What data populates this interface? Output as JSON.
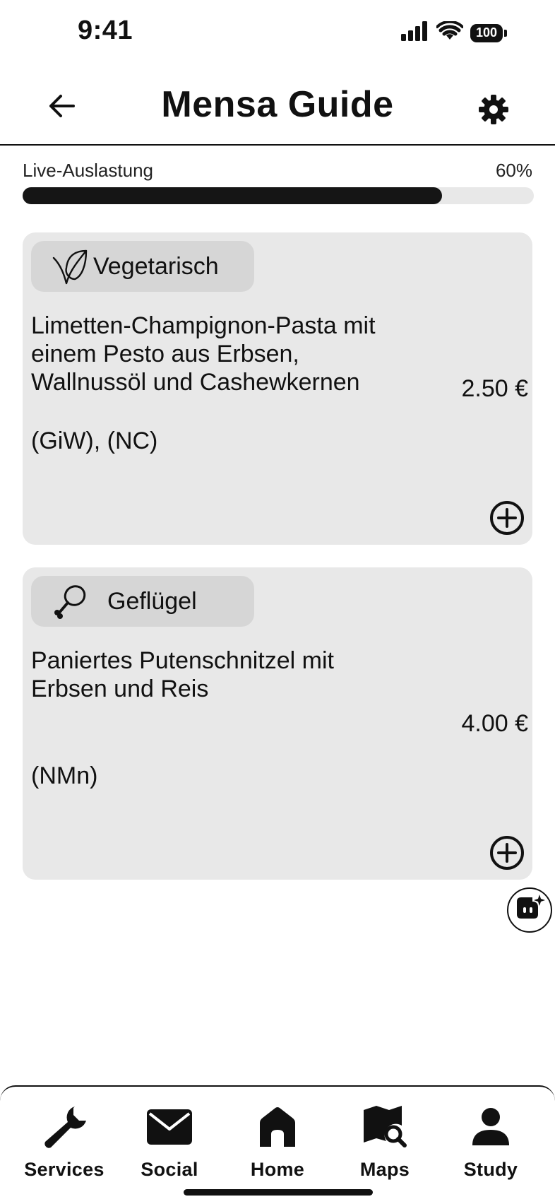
{
  "status_bar": {
    "time": "9:41",
    "battery": "100"
  },
  "header": {
    "title": "Mensa Guide",
    "back_icon": "arrow-left-icon",
    "settings_icon": "gear-icon"
  },
  "utilization": {
    "label": "Live-Auslastung",
    "value_text": "60%",
    "fraction": 0.82
  },
  "meals": [
    {
      "category": "Vegetarisch",
      "category_icon": "leaf-icon",
      "name": "Limetten-Champignon-Pasta mit einem Pesto aus Erbsen, Wallnussöl und Cashewkernen",
      "price": "2.50 €",
      "codes": "(GiW), (NC)"
    },
    {
      "category": "Geflügel",
      "category_icon": "drumstick-icon",
      "name": "Paniertes Putenschnitzel mit Erbsen und Reis",
      "price": "4.00 €",
      "codes": "(NMn)"
    }
  ],
  "nav": {
    "items": [
      {
        "label": "Services",
        "icon": "wrench-icon"
      },
      {
        "label": "Social",
        "icon": "mail-icon"
      },
      {
        "label": "Home",
        "icon": "home-icon"
      },
      {
        "label": "Maps",
        "icon": "map-search-icon"
      },
      {
        "label": "Study",
        "icon": "person-icon"
      }
    ]
  },
  "colors": {
    "card": "#e8e8e8",
    "badge": "#d6d6d6",
    "progress_fill": "#151515",
    "progress_track": "#e8e8e8"
  }
}
